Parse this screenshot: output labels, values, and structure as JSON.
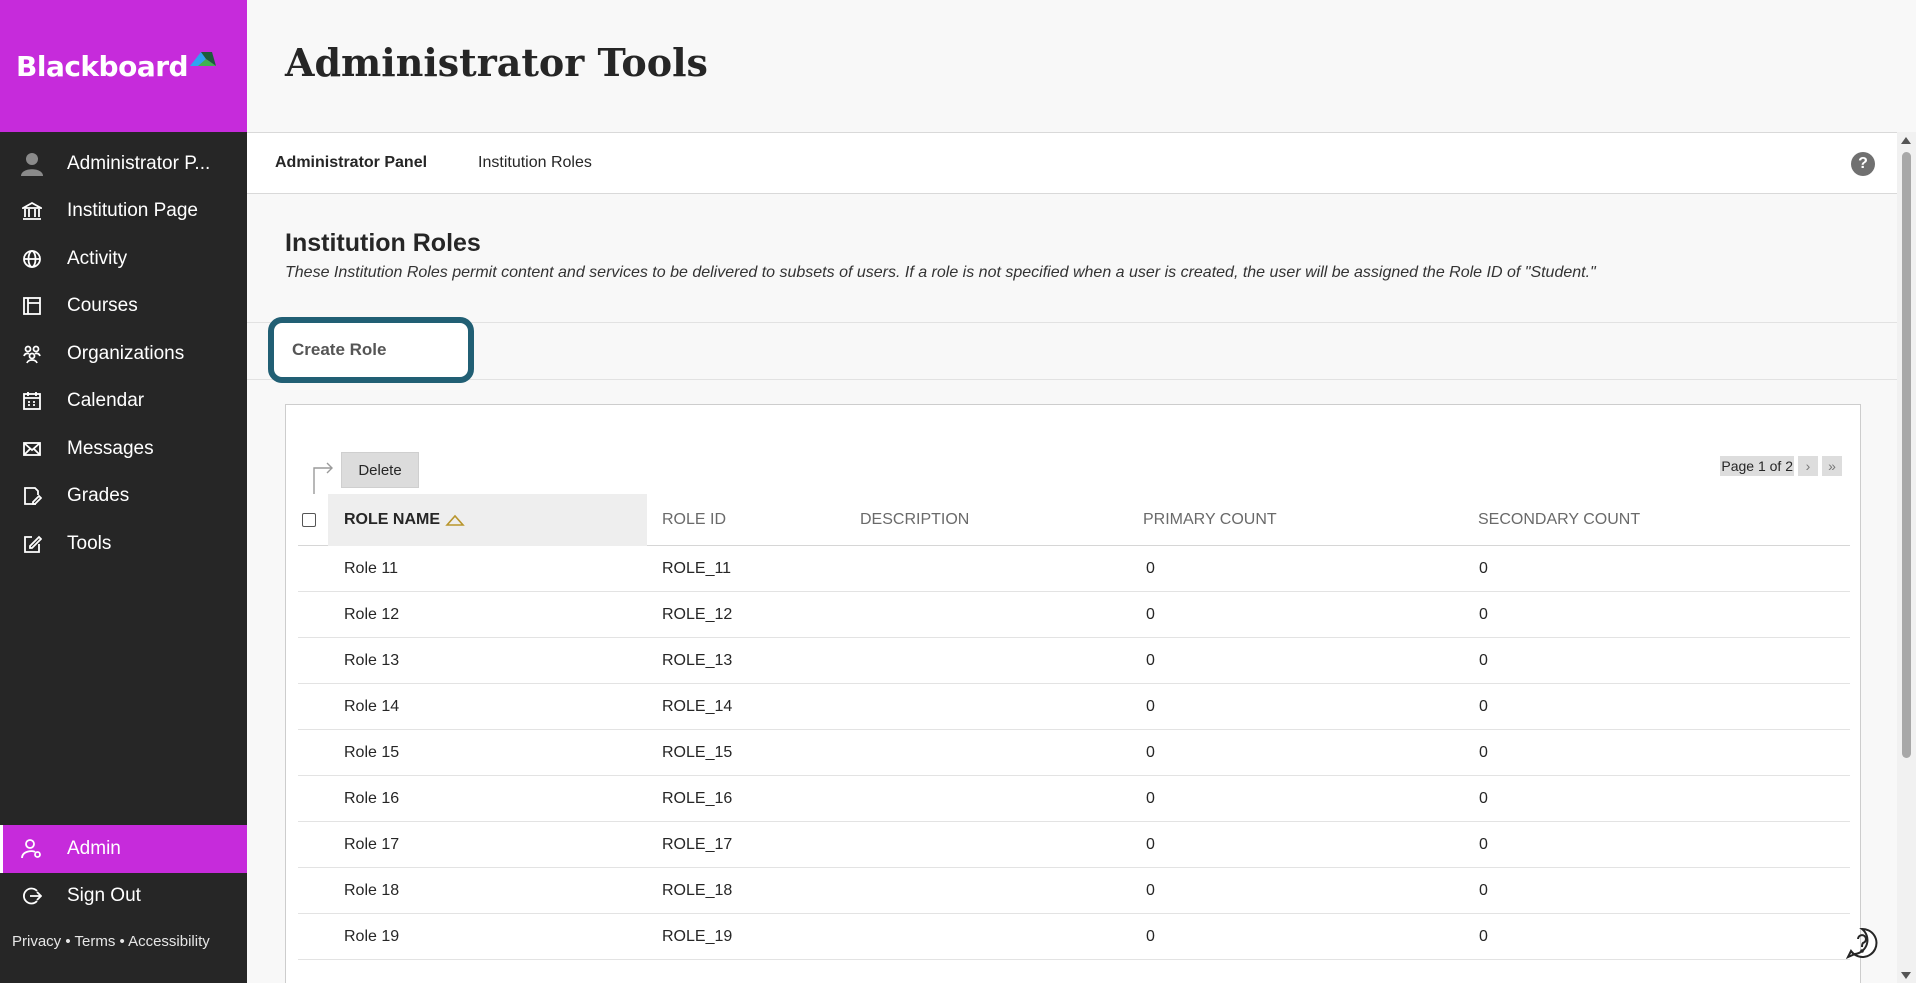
{
  "brand": {
    "name": "Blackboard",
    "accent": "#c62bdb"
  },
  "sidebar": {
    "items": [
      {
        "label": "Administrator P...",
        "icon": "user-avatar-icon"
      },
      {
        "label": "Institution Page",
        "icon": "institution-icon"
      },
      {
        "label": "Activity",
        "icon": "globe-icon"
      },
      {
        "label": "Courses",
        "icon": "courses-icon"
      },
      {
        "label": "Organizations",
        "icon": "organizations-icon"
      },
      {
        "label": "Calendar",
        "icon": "calendar-icon"
      },
      {
        "label": "Messages",
        "icon": "envelope-icon"
      },
      {
        "label": "Grades",
        "icon": "grades-icon"
      },
      {
        "label": "Tools",
        "icon": "tools-icon"
      }
    ],
    "admin_label": "Admin",
    "signout_label": "Sign Out",
    "footer": "Privacy • Terms • Accessibility"
  },
  "header": {
    "title": "Administrator Tools"
  },
  "breadcrumbs": {
    "first": "Administrator Panel",
    "second": "Institution Roles",
    "help": "?"
  },
  "section": {
    "title": "Institution Roles",
    "description": "These Institution Roles permit content and services to be delivered to subsets of users. If a role is not specified when a user is created, the user will be assigned the Role ID of \"Student.\""
  },
  "actions": {
    "create_role": "Create Role",
    "delete": "Delete"
  },
  "pager": {
    "text": "Page 1 of 2",
    "next": "›",
    "last": "»"
  },
  "table": {
    "headers": {
      "role_name": "ROLE NAME",
      "role_id": "ROLE ID",
      "description": "DESCRIPTION",
      "primary_count": "PRIMARY COUNT",
      "secondary_count": "SECONDARY COUNT"
    },
    "rows": [
      {
        "name": "Role 11",
        "id": "ROLE_11",
        "desc": "",
        "primary": "0",
        "secondary": "0"
      },
      {
        "name": "Role 12",
        "id": "ROLE_12",
        "desc": "",
        "primary": "0",
        "secondary": "0"
      },
      {
        "name": "Role 13",
        "id": "ROLE_13",
        "desc": "",
        "primary": "0",
        "secondary": "0"
      },
      {
        "name": "Role 14",
        "id": "ROLE_14",
        "desc": "",
        "primary": "0",
        "secondary": "0"
      },
      {
        "name": "Role 15",
        "id": "ROLE_15",
        "desc": "",
        "primary": "0",
        "secondary": "0"
      },
      {
        "name": "Role 16",
        "id": "ROLE_16",
        "desc": "",
        "primary": "0",
        "secondary": "0"
      },
      {
        "name": "Role 17",
        "id": "ROLE_17",
        "desc": "",
        "primary": "0",
        "secondary": "0"
      },
      {
        "name": "Role 18",
        "id": "ROLE_18",
        "desc": "",
        "primary": "0",
        "secondary": "0"
      },
      {
        "name": "Role 19",
        "id": "ROLE_19",
        "desc": "",
        "primary": "0",
        "secondary": "0"
      }
    ]
  }
}
